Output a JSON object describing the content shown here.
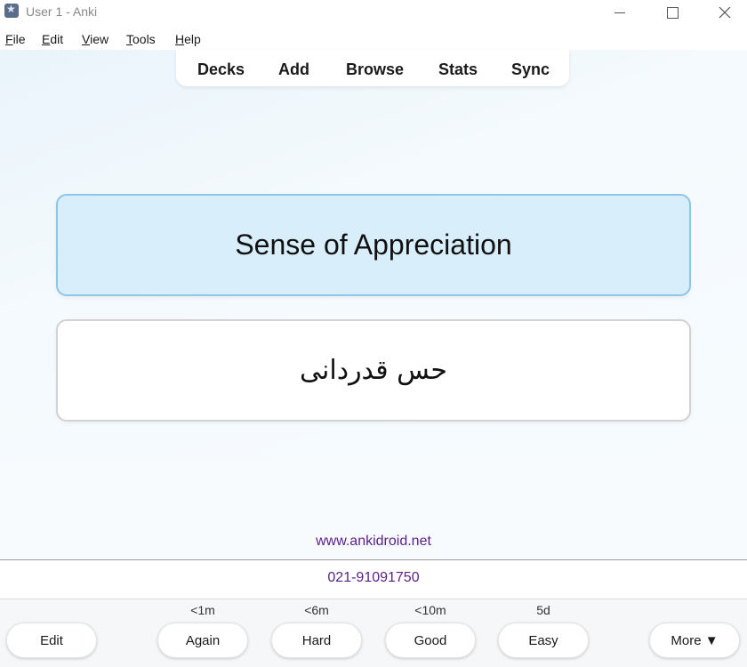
{
  "window": {
    "title": "User 1 - Anki",
    "icons": {
      "app": "anki-star-icon",
      "minimize": "minimize-icon",
      "maximize": "maximize-icon",
      "close": "close-icon"
    }
  },
  "menu": {
    "items": [
      {
        "label": "File",
        "accel": "F"
      },
      {
        "label": "Edit",
        "accel": "E"
      },
      {
        "label": "View",
        "accel": "V"
      },
      {
        "label": "Tools",
        "accel": "T"
      },
      {
        "label": "Help",
        "accel": "H"
      }
    ]
  },
  "toolbar": {
    "items": [
      "Decks",
      "Add",
      "Browse",
      "Stats",
      "Sync"
    ]
  },
  "card": {
    "front": "Sense of Appreciation",
    "back": "حس قدردانی"
  },
  "footer": {
    "website": "www.ankidroid.net",
    "phone": "021-91091750"
  },
  "answer_bar": {
    "edit_label": "Edit",
    "buttons": [
      {
        "label": "Again",
        "interval": "<1m"
      },
      {
        "label": "Hard",
        "interval": "<6m"
      },
      {
        "label": "Good",
        "interval": "<10m"
      },
      {
        "label": "Easy",
        "interval": "5d"
      }
    ],
    "more_label": "More ▼"
  },
  "colors": {
    "front_card_bg": "#d9eefb",
    "front_card_border": "#8dc6e8",
    "link_text": "#5b1f8a"
  }
}
